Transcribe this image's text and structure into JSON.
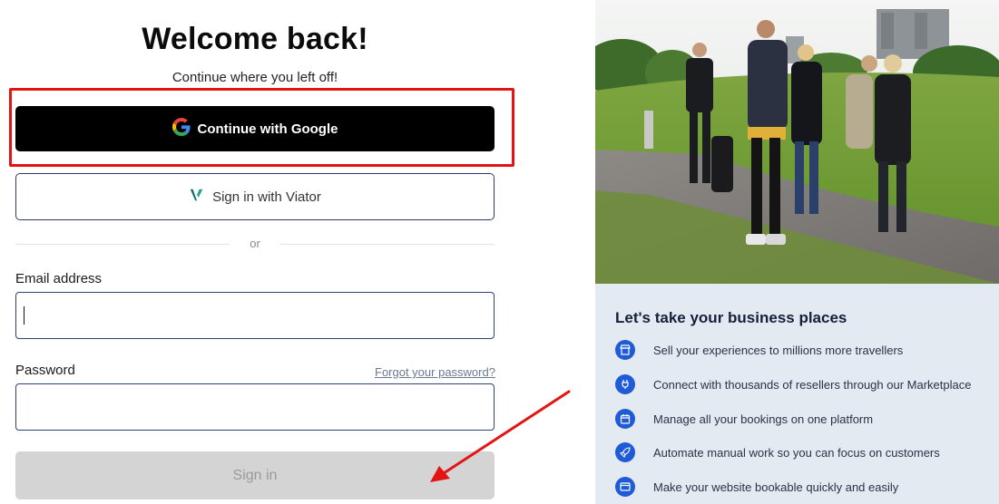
{
  "login": {
    "title": "Welcome back!",
    "subtitle": "Continue where you left off!",
    "google_button": "Continue with Google",
    "viator_button": "Sign in with Viator",
    "divider_text": "or",
    "email_label": "Email address",
    "email_value": "",
    "password_label": "Password",
    "password_value": "",
    "forgot_link": "Forgot your password?",
    "signin_button": "Sign in"
  },
  "marketing": {
    "photo_icon": "group-walking-photo",
    "heading": "Let's take your business places",
    "features": [
      {
        "icon": "storefront-icon",
        "text": "Sell your experiences to millions more travellers"
      },
      {
        "icon": "plug-icon",
        "text": "Connect with thousands of resellers through our Marketplace"
      },
      {
        "icon": "calendar-icon",
        "text": "Manage all your bookings on one platform"
      },
      {
        "icon": "rocket-icon",
        "text": "Automate manual work so you can focus on customers"
      },
      {
        "icon": "browser-window-icon",
        "text": "Make your website bookable quickly and easily"
      }
    ]
  },
  "annotations": {
    "highlight_color": "#e41414",
    "arrow_color": "#e41414"
  },
  "colors": {
    "primary_button": "#000000",
    "accent_blue": "#1f5bd6",
    "disabled_button": "#d4d4d4",
    "right_panel_bg": "#e4eaf1"
  }
}
